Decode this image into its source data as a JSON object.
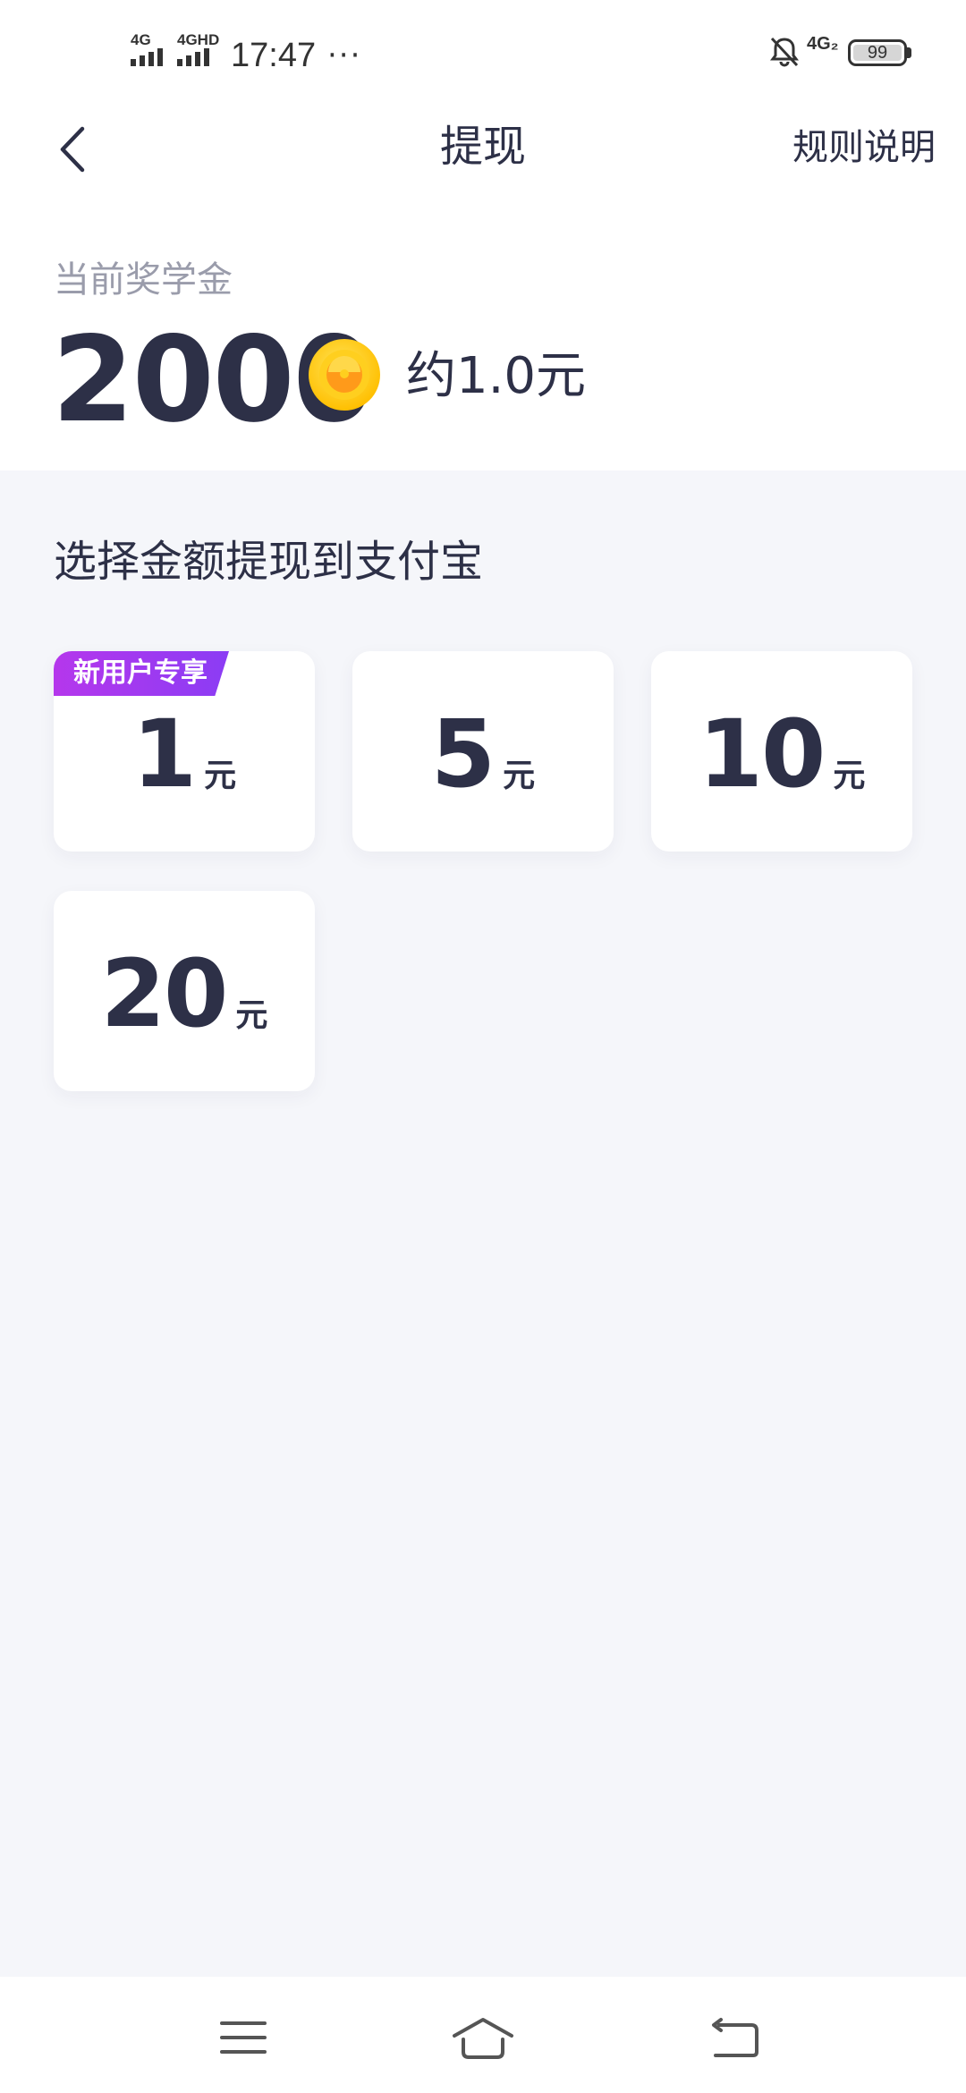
{
  "status_bar": {
    "signal1_label": "4G",
    "signal2_label": "4GHD",
    "time": "17:47",
    "more_indicator": "···",
    "network2_label": "4G₂",
    "battery_level": "99"
  },
  "nav": {
    "title": "提现",
    "rules_label": "规则说明"
  },
  "balance": {
    "label": "当前奖学金",
    "amount": "2000",
    "approx": "约1.0元"
  },
  "withdraw": {
    "section_title": "选择金额提现到支付宝",
    "options": [
      {
        "value": "1",
        "unit": "元",
        "badge": "新用户专享"
      },
      {
        "value": "5",
        "unit": "元"
      },
      {
        "value": "10",
        "unit": "元"
      },
      {
        "value": "20",
        "unit": "元"
      }
    ]
  },
  "colors": {
    "primary_text": "#2d3047",
    "secondary_text": "#9a9cab",
    "page_bg": "#f5f6fa",
    "badge_gradient_start": "#b537ec",
    "badge_gradient_end": "#8b3cf4",
    "coin": "#ffc107"
  },
  "icons": {
    "back": "chevron-left-icon",
    "coin": "coin-icon",
    "silent": "bell-off-icon",
    "menu": "menu-icon",
    "home": "home-icon",
    "return": "return-icon"
  }
}
